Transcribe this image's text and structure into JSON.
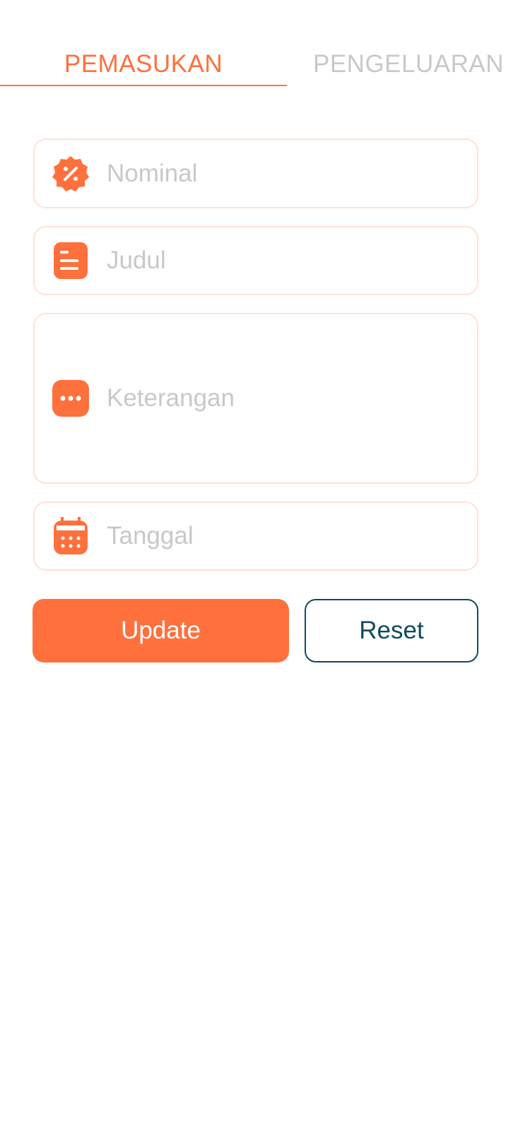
{
  "tabs": [
    {
      "label": "PEMASUKAN",
      "active": true
    },
    {
      "label": "PENGELUARAN",
      "active": false
    }
  ],
  "form": {
    "nominal": {
      "placeholder": "Nominal",
      "value": "",
      "icon": "discount-badge-icon"
    },
    "judul": {
      "placeholder": "Judul",
      "value": "",
      "icon": "document-icon"
    },
    "keterangan": {
      "placeholder": "Keterangan",
      "value": "",
      "icon": "more-dots-icon"
    },
    "tanggal": {
      "placeholder": "Tanggal",
      "value": "",
      "icon": "calendar-icon"
    }
  },
  "buttons": {
    "update": "Update",
    "reset": "Reset"
  },
  "colors": {
    "accent": "#FF703D",
    "secondary": "#124A5A",
    "field_border": "#fde2d8",
    "placeholder": "#c8c8c8"
  }
}
